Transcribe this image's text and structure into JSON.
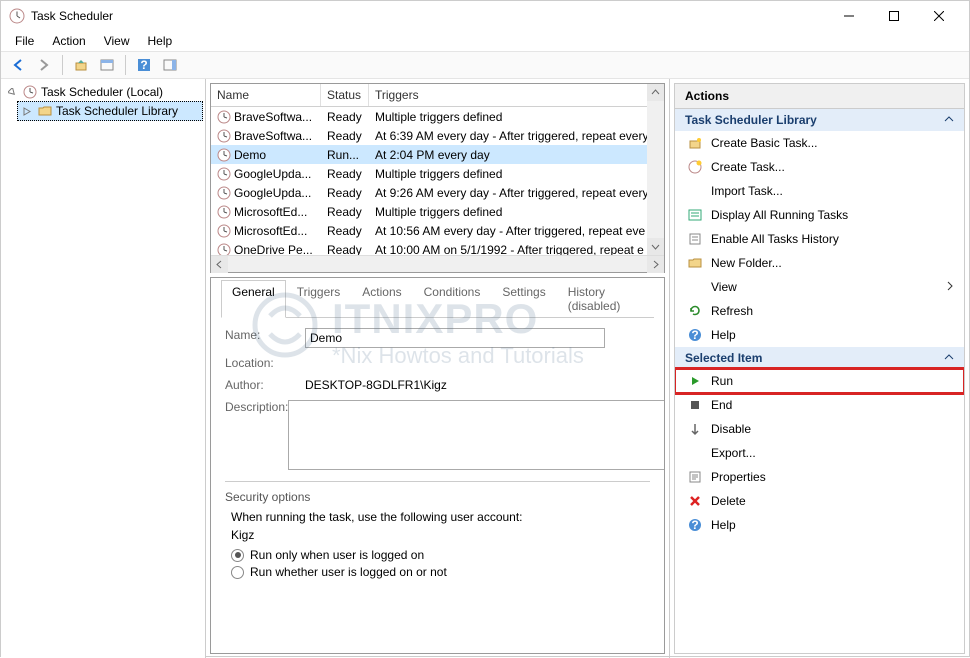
{
  "window": {
    "title": "Task Scheduler"
  },
  "menubar": [
    "File",
    "Action",
    "View",
    "Help"
  ],
  "tree": {
    "root": "Task Scheduler (Local)",
    "child": "Task Scheduler Library"
  },
  "list": {
    "headers": {
      "name": "Name",
      "status": "Status",
      "triggers": "Triggers"
    },
    "rows": [
      {
        "name": "BraveSoftwa...",
        "status": "Ready",
        "triggers": "Multiple triggers defined"
      },
      {
        "name": "BraveSoftwa...",
        "status": "Ready",
        "triggers": "At 6:39 AM every day - After triggered, repeat every"
      },
      {
        "name": "Demo",
        "status": "Run...",
        "triggers": "At 2:04 PM every day",
        "selected": true
      },
      {
        "name": "GoogleUpda...",
        "status": "Ready",
        "triggers": "Multiple triggers defined"
      },
      {
        "name": "GoogleUpda...",
        "status": "Ready",
        "triggers": "At 9:26 AM every day - After triggered, repeat every"
      },
      {
        "name": "MicrosoftEd...",
        "status": "Ready",
        "triggers": "Multiple triggers defined"
      },
      {
        "name": "MicrosoftEd...",
        "status": "Ready",
        "triggers": "At 10:56 AM every day - After triggered, repeat eve"
      },
      {
        "name": "OneDrive Pe...",
        "status": "Ready",
        "triggers": "At 10:00 AM on 5/1/1992 - After triggered, repeat e"
      }
    ]
  },
  "tabs": [
    "General",
    "Triggers",
    "Actions",
    "Conditions",
    "Settings",
    "History (disabled)"
  ],
  "details": {
    "name_label": "Name:",
    "name_value": "Demo",
    "location_label": "Location:",
    "location_value": "",
    "author_label": "Author:",
    "author_value": "DESKTOP-8GDLFR1\\Kigz",
    "description_label": "Description:",
    "description_value": "",
    "security": {
      "title": "Security options",
      "prompt": "When running the task, use the following user account:",
      "user": "Kigz",
      "radio1": "Run only when user is logged on",
      "radio2": "Run whether user is logged on or not"
    }
  },
  "actions": {
    "title": "Actions",
    "section1": "Task Scheduler Library",
    "items1": [
      {
        "icon": "wizard-icon",
        "label": "Create Basic Task..."
      },
      {
        "icon": "new-task-icon",
        "label": "Create Task..."
      },
      {
        "icon": "",
        "label": "Import Task..."
      },
      {
        "icon": "running-tasks-icon",
        "label": "Display All Running Tasks"
      },
      {
        "icon": "history-icon",
        "label": "Enable All Tasks History"
      },
      {
        "icon": "folder-icon",
        "label": "New Folder..."
      },
      {
        "icon": "",
        "label": "View",
        "arrow": true
      },
      {
        "icon": "refresh-icon",
        "label": "Refresh"
      },
      {
        "icon": "help-icon",
        "label": "Help"
      }
    ],
    "section2": "Selected Item",
    "items2": [
      {
        "icon": "run-icon",
        "label": "Run",
        "highlight": true
      },
      {
        "icon": "end-icon",
        "label": "End"
      },
      {
        "icon": "disable-icon",
        "label": "Disable"
      },
      {
        "icon": "",
        "label": "Export..."
      },
      {
        "icon": "properties-icon",
        "label": "Properties"
      },
      {
        "icon": "delete-icon",
        "label": "Delete"
      },
      {
        "icon": "help-icon",
        "label": "Help"
      }
    ]
  },
  "watermark": {
    "line1": "ITNIXPRO",
    "line2": "*Nix Howtos and Tutorials"
  }
}
